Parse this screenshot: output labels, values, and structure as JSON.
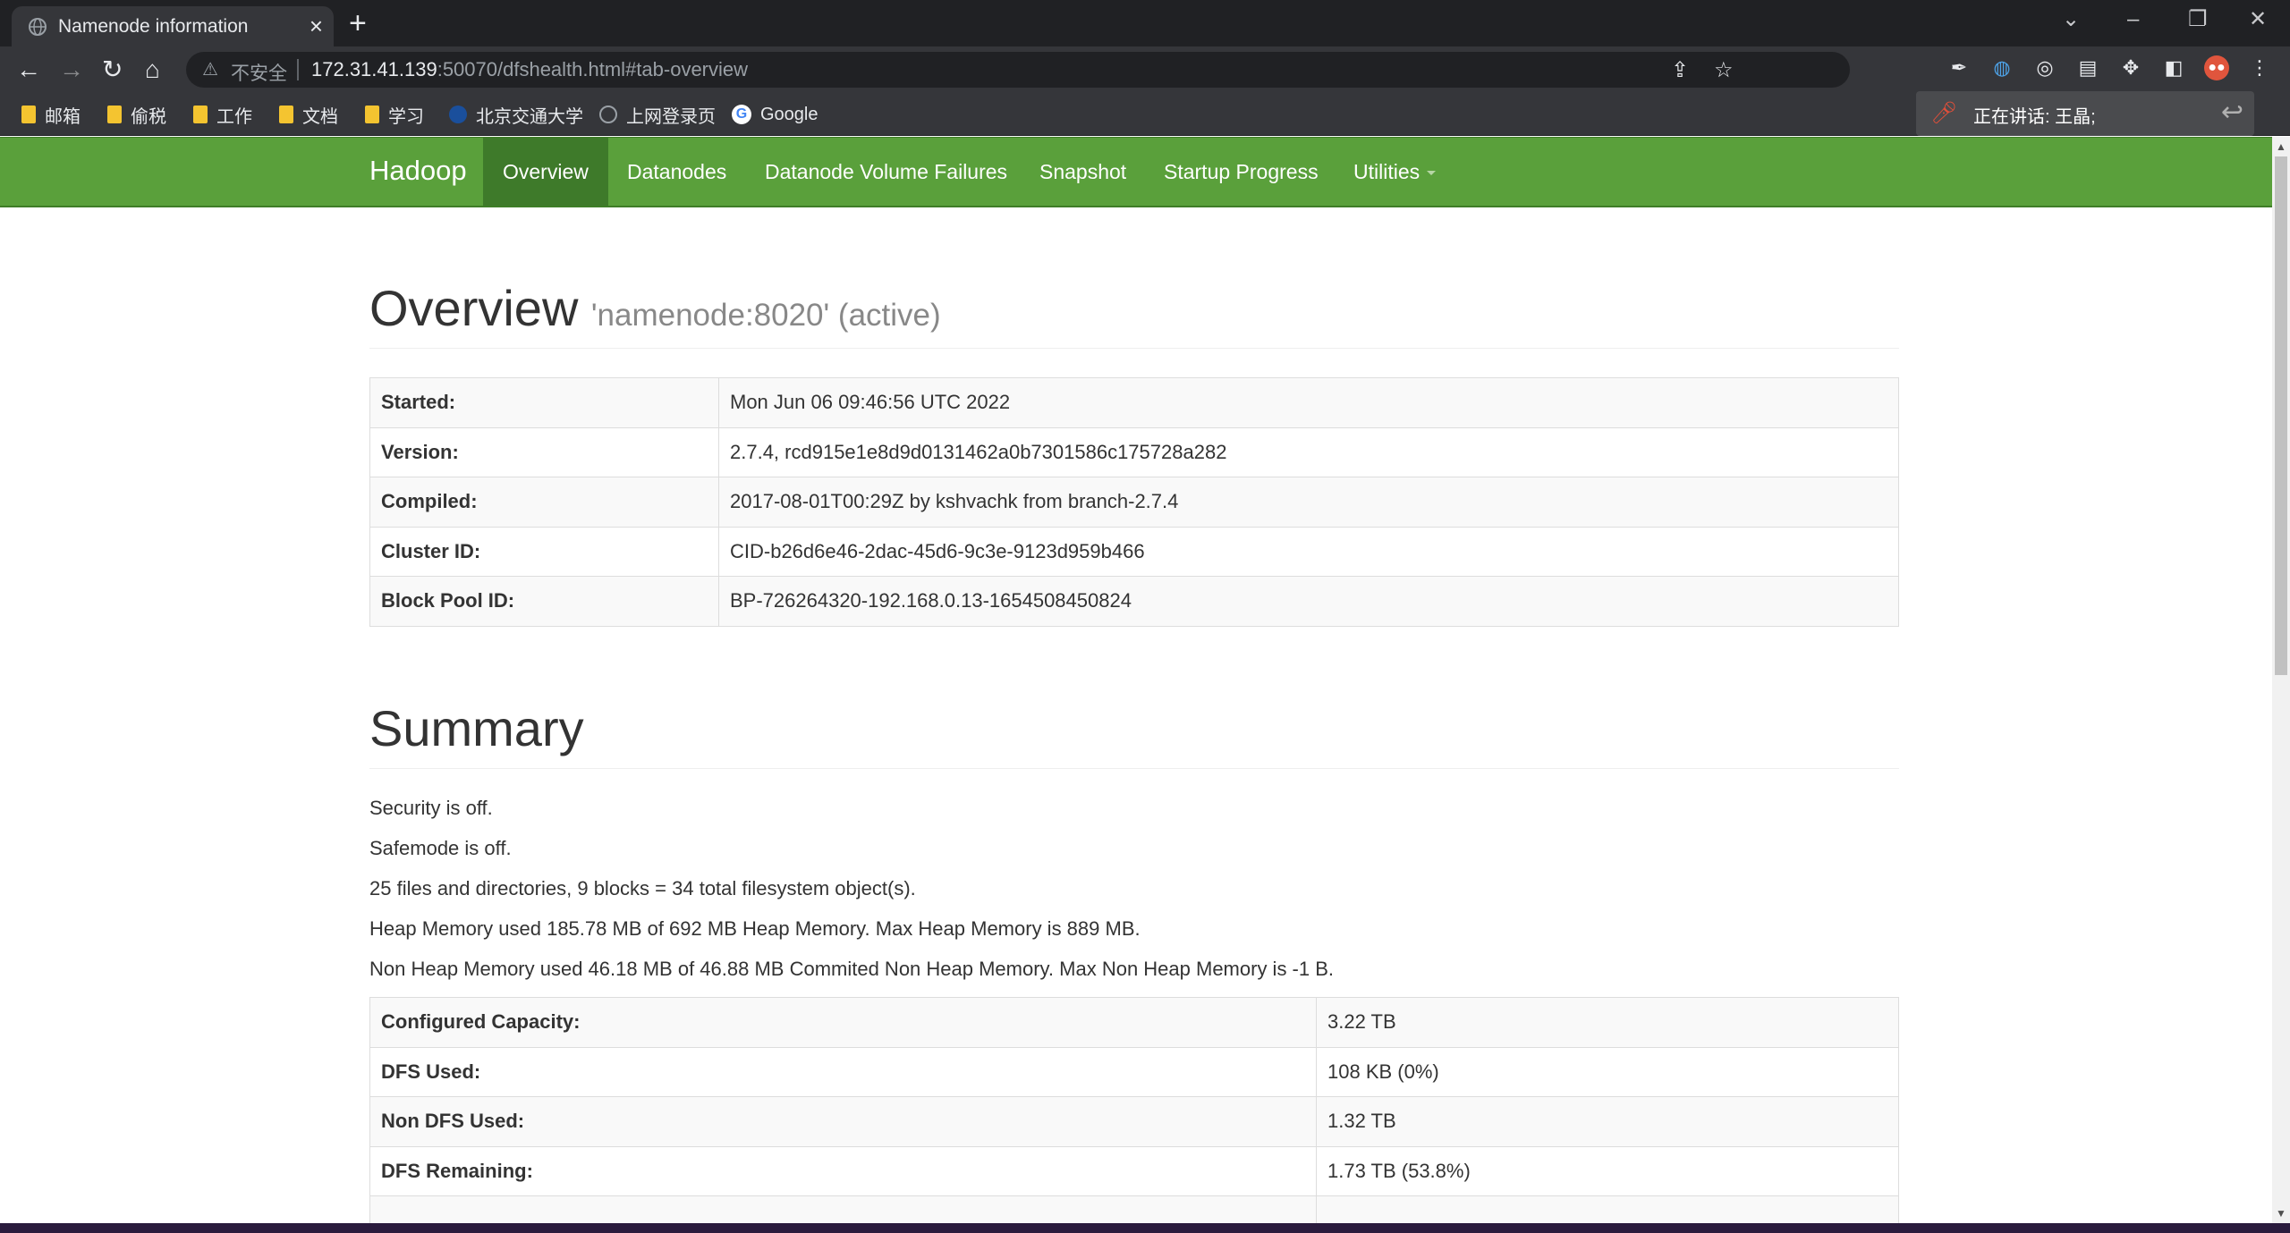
{
  "browser": {
    "tab_title": "Namenode information",
    "tab_close": "×",
    "new_tab": "+",
    "window_controls": {
      "minimize": "–",
      "restore": "❐",
      "close": "✕",
      "search_tabs": "⌄"
    },
    "address": {
      "security_text": "不安全",
      "host": "172.31.41.139",
      "path": ":50070/dfshealth.html#tab-overview"
    },
    "nav": {
      "back": "←",
      "forward": "→",
      "reload": "↻",
      "home": "⌂"
    },
    "bookmarks": [
      "邮箱",
      "偷税",
      "工作",
      "文档",
      "学习",
      "北京交通大学",
      "上网登录页",
      "Google"
    ],
    "speaking_banner": "正在讲话: 王晶;"
  },
  "hadoop": {
    "brand": "Hadoop",
    "nav": [
      "Overview",
      "Datanodes",
      "Datanode Volume Failures",
      "Snapshot",
      "Startup Progress",
      "Utilities"
    ],
    "active_nav": "Overview",
    "overview": {
      "title": "Overview",
      "subtitle": "'namenode:8020' (active)",
      "rows": [
        {
          "label": "Started:",
          "value": "Mon Jun 06 09:46:56 UTC 2022"
        },
        {
          "label": "Version:",
          "value": "2.7.4, rcd915e1e8d9d0131462a0b7301586c175728a282"
        },
        {
          "label": "Compiled:",
          "value": "2017-08-01T00:29Z by kshvachk from branch-2.7.4"
        },
        {
          "label": "Cluster ID:",
          "value": "CID-b26d6e46-2dac-45d6-9c3e-9123d959b466"
        },
        {
          "label": "Block Pool ID:",
          "value": "BP-726264320-192.168.0.13-1654508450824"
        }
      ]
    },
    "summary": {
      "title": "Summary",
      "lines": [
        "Security is off.",
        "Safemode is off.",
        "25 files and directories, 9 blocks = 34 total filesystem object(s).",
        "Heap Memory used 185.78 MB of 692 MB Heap Memory. Max Heap Memory is 889 MB.",
        "Non Heap Memory used 46.18 MB of 46.88 MB Commited Non Heap Memory. Max Non Heap Memory is -1 B."
      ],
      "rows": [
        {
          "label": "Configured Capacity:",
          "value": "3.22 TB"
        },
        {
          "label": "DFS Used:",
          "value": "108 KB (0%)"
        },
        {
          "label": "Non DFS Used:",
          "value": "1.32 TB"
        },
        {
          "label": "DFS Remaining:",
          "value": "1.73 TB (53.8%)"
        }
      ]
    }
  }
}
